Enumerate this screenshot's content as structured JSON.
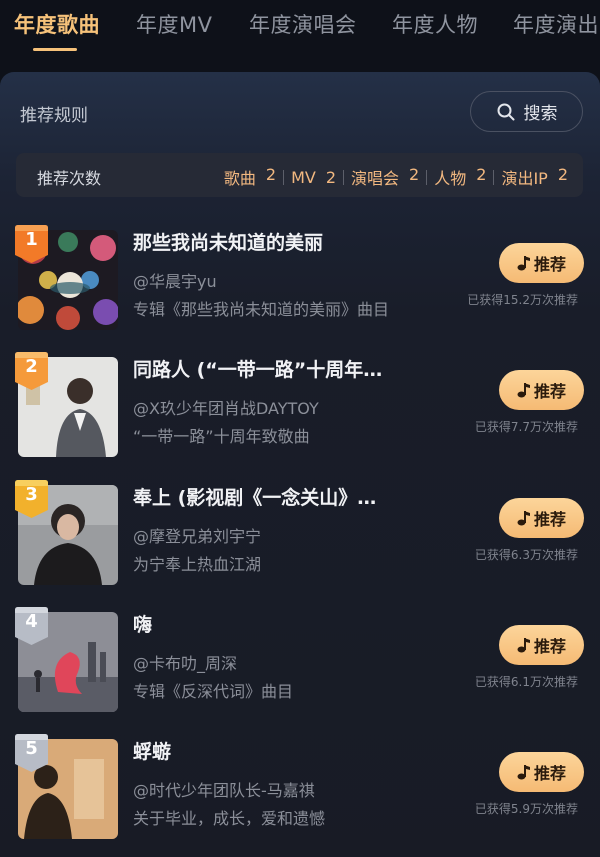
{
  "tabs": [
    {
      "label": "年度歌曲",
      "active": true
    },
    {
      "label": "年度MV",
      "active": false
    },
    {
      "label": "年度演唱会",
      "active": false
    },
    {
      "label": "年度人物",
      "active": false
    },
    {
      "label": "年度演出",
      "active": false
    }
  ],
  "panel": {
    "rules_label": "推荐规则",
    "search_label": "搜索",
    "count_label": "推荐次数",
    "counts": [
      {
        "name": "歌曲",
        "value": "2"
      },
      {
        "name": "MV",
        "value": "2"
      },
      {
        "name": "演唱会",
        "value": "2"
      },
      {
        "name": "人物",
        "value": "2"
      },
      {
        "name": "演出IP",
        "value": "2"
      }
    ]
  },
  "songs": [
    {
      "rank": "1",
      "title": "那些我尚未知道的美丽",
      "artist": "@华晨宇yu",
      "desc": "专辑《那些我尚未知道的美丽》曲目",
      "button": "推荐",
      "count": "已获得15.2万次推荐",
      "badge_color": "#f27a28"
    },
    {
      "rank": "2",
      "title": "同路人 (“一带一路”十周年…",
      "artist": "@X玖少年团肖战DAYTOY",
      "desc": "“一带一路”十周年致敬曲",
      "button": "推荐",
      "count": "已获得7.7万次推荐",
      "badge_color": "#f59a3a"
    },
    {
      "rank": "3",
      "title": "奉上 (影视剧《一念关山》…",
      "artist": "@摩登兄弟刘宇宁",
      "desc": "为宁奉上热血江湖",
      "button": "推荐",
      "count": "已获得6.3万次推荐",
      "badge_color": "#f2b12c"
    },
    {
      "rank": "4",
      "title": "嗨",
      "artist": "@卡布叻_周深",
      "desc": "专辑《反深代词》曲目",
      "button": "推荐",
      "count": "已获得6.1万次推荐",
      "badge_color": "#b7bcc6"
    },
    {
      "rank": "5",
      "title": "蜉蝣",
      "artist": "@时代少年团队长-马嘉祺",
      "desc": "关于毕业，成长，爱和遗憾",
      "button": "推荐",
      "count": "已获得5.9万次推荐",
      "badge_color": "#b7bcc6"
    }
  ],
  "colors": {
    "accent": "#f6c27a",
    "button": "#f5ba74"
  }
}
